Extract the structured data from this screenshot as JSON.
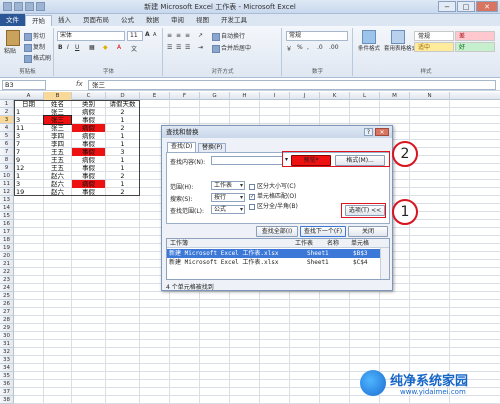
{
  "window": {
    "title": "新建 Microsoft Excel 工作表 - Microsoft Excel",
    "controls": [
      "−",
      "□",
      "✕"
    ]
  },
  "ribbon": {
    "tabs": [
      "文件",
      "开始",
      "插入",
      "页面布局",
      "公式",
      "数据",
      "审阅",
      "视图",
      "开发工具"
    ],
    "active_tab": "开始",
    "clipboard": {
      "paste": "粘贴",
      "cut": "剪切",
      "copy": "复制",
      "format_painter": "格式刷",
      "label": "剪贴板"
    },
    "font": {
      "name": "宋体",
      "size": "11",
      "label": "字体"
    },
    "alignment": {
      "wrap": "自动换行",
      "merge": "合并后居中",
      "label": "对齐方式"
    },
    "number": {
      "format": "常规",
      "label": "数字"
    },
    "styles": {
      "conditional": "条件格式",
      "table": "套用表格格式",
      "normal": "常规",
      "bad": "差",
      "neutral": "适中",
      "good": "好",
      "label": "样式"
    }
  },
  "formula_bar": {
    "name_box": "B3",
    "fx": "fx",
    "content": "张三"
  },
  "sheet": {
    "columns": [
      "A",
      "B",
      "C",
      "D",
      "E",
      "F",
      "G",
      "H",
      "I",
      "J",
      "K",
      "L",
      "M",
      "N"
    ],
    "rows": [
      "1",
      "2",
      "3",
      "4",
      "5",
      "6",
      "7",
      "8",
      "9",
      "10",
      "11",
      "12",
      "13",
      "14",
      "15",
      "16",
      "17",
      "18",
      "19",
      "20",
      "21",
      "22",
      "23",
      "24",
      "25",
      "26",
      "27",
      "28",
      "29",
      "30",
      "31",
      "32",
      "33",
      "34",
      "35",
      "36",
      "37",
      "38"
    ],
    "data": [
      [
        "日期",
        "姓名",
        "类别",
        "请假天数"
      ],
      [
        "1",
        "张三",
        "病假",
        "2"
      ],
      [
        "3",
        "张三",
        "事假",
        "1"
      ],
      [
        "11",
        "张三",
        "病假",
        "2"
      ],
      [
        "3",
        "李四",
        "病假",
        "1"
      ],
      [
        "7",
        "李四",
        "事假",
        "1"
      ],
      [
        "7",
        "王五",
        "事假",
        "3"
      ],
      [
        "9",
        "王五",
        "病假",
        "1"
      ],
      [
        "12",
        "王五",
        "事假",
        "1"
      ],
      [
        "1",
        "赵六",
        "事假",
        "2"
      ],
      [
        "3",
        "赵六",
        "病假",
        "1"
      ],
      [
        "19",
        "赵六",
        "事假",
        "2"
      ]
    ]
  },
  "dialog": {
    "title": "查找和替换",
    "help": "?",
    "close": "✕",
    "tab_find": "查找(D)",
    "tab_replace": "替换(P)",
    "find_label": "查找内容(N):",
    "preview_button": "预览*",
    "format_button": "格式(M)...",
    "scope_label": "范围(H):",
    "scope_value": "工作表",
    "search_label": "搜索(S):",
    "search_value": "按行",
    "lookin_label": "查找范围(L):",
    "lookin_value": "公式",
    "match_case": "区分大小写(C)",
    "match_cell": "单元格匹配(O)",
    "match_width": "区分全/半角(B)",
    "options_button": "选项(T) <<",
    "find_all": "查找全部(I)",
    "find_next": "查找下一个(F)",
    "close_button": "关闭",
    "results_headers": [
      "工作簿",
      "工作表",
      "名称",
      "单元格"
    ],
    "results": [
      [
        "新建 Microsoft Excel 工作表.xlsx",
        "Sheet1",
        "",
        "$B$3"
      ],
      [
        "新建 Microsoft Excel 工作表.xlsx",
        "Sheet1",
        "",
        "$C$4"
      ]
    ],
    "status": "4 个单元格被找到"
  },
  "annotations": [
    "1",
    "2"
  ],
  "watermark": {
    "name": "纯净系统家园",
    "url": "www.yidaimei.com"
  }
}
